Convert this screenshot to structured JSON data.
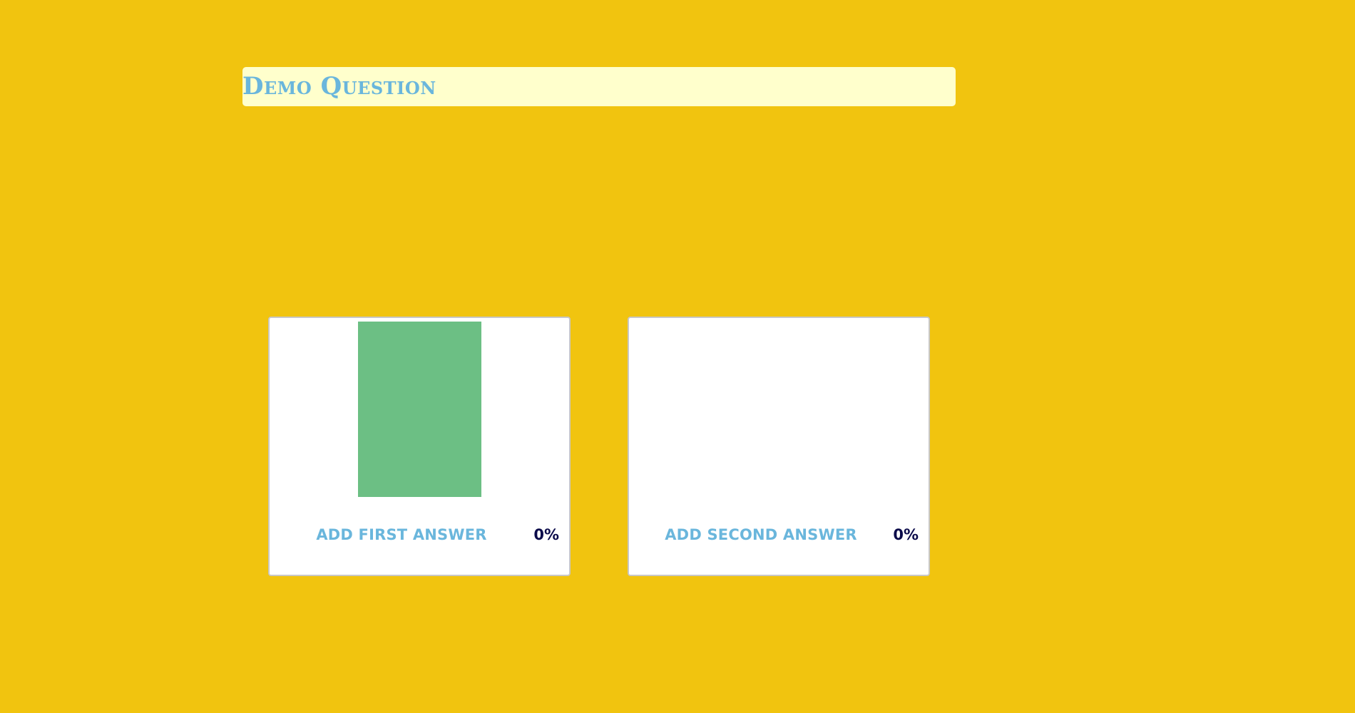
{
  "question": {
    "title": "Demo Question"
  },
  "answers": [
    {
      "label": "Add first answer",
      "percent_text": "0%",
      "bar_fill_fraction": 1.0,
      "bar_color": "#6cbf84"
    },
    {
      "label": "Add second answer",
      "percent_text": "0%",
      "bar_fill_fraction": 0,
      "bar_color": "#6cbf84"
    }
  ],
  "colors": {
    "background": "#f1c40f",
    "question_bar": "#ffffcc",
    "label_text": "#6ab6dc",
    "percent_text": "#0b0b4a",
    "card_border": "#c8c8c8"
  }
}
